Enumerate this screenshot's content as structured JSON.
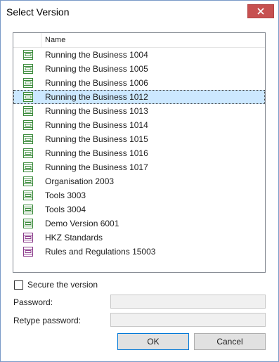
{
  "window": {
    "title": "Select Version"
  },
  "list": {
    "column_header": "Name",
    "selected_index": 3,
    "items": [
      {
        "label": "Running the Business 1004",
        "icon": "version-green-icon"
      },
      {
        "label": "Running the Business 1005",
        "icon": "version-green-icon"
      },
      {
        "label": "Running the Business 1006",
        "icon": "version-green-icon"
      },
      {
        "label": "Running the Business 1012",
        "icon": "version-green-icon"
      },
      {
        "label": "Running the Business 1013",
        "icon": "version-green-icon"
      },
      {
        "label": "Running the Business 1014",
        "icon": "version-green-icon"
      },
      {
        "label": "Running the Business 1015",
        "icon": "version-green-icon"
      },
      {
        "label": "Running the Business 1016",
        "icon": "version-green-icon"
      },
      {
        "label": "Running the Business 1017",
        "icon": "version-green-icon"
      },
      {
        "label": "Organisation 2003",
        "icon": "version-green-icon"
      },
      {
        "label": "Tools 3003",
        "icon": "version-green-icon"
      },
      {
        "label": "Tools 3004",
        "icon": "version-green-icon"
      },
      {
        "label": "Demo Version 6001",
        "icon": "version-green-icon"
      },
      {
        "label": "HKZ Standards",
        "icon": "version-purple-icon"
      },
      {
        "label": "Rules and Regulations 15003",
        "icon": "version-purple-icon"
      }
    ]
  },
  "secure": {
    "label": "Secure the version",
    "checked": false
  },
  "password": {
    "label": "Password:",
    "value": ""
  },
  "retype_password": {
    "label": "Retype password:",
    "value": ""
  },
  "buttons": {
    "ok": "OK",
    "cancel": "Cancel"
  },
  "colors": {
    "green_icon": "#3a8a3a",
    "purple_icon": "#8a3a8a",
    "selection": "#cce8ff",
    "close_button": "#c75050"
  }
}
